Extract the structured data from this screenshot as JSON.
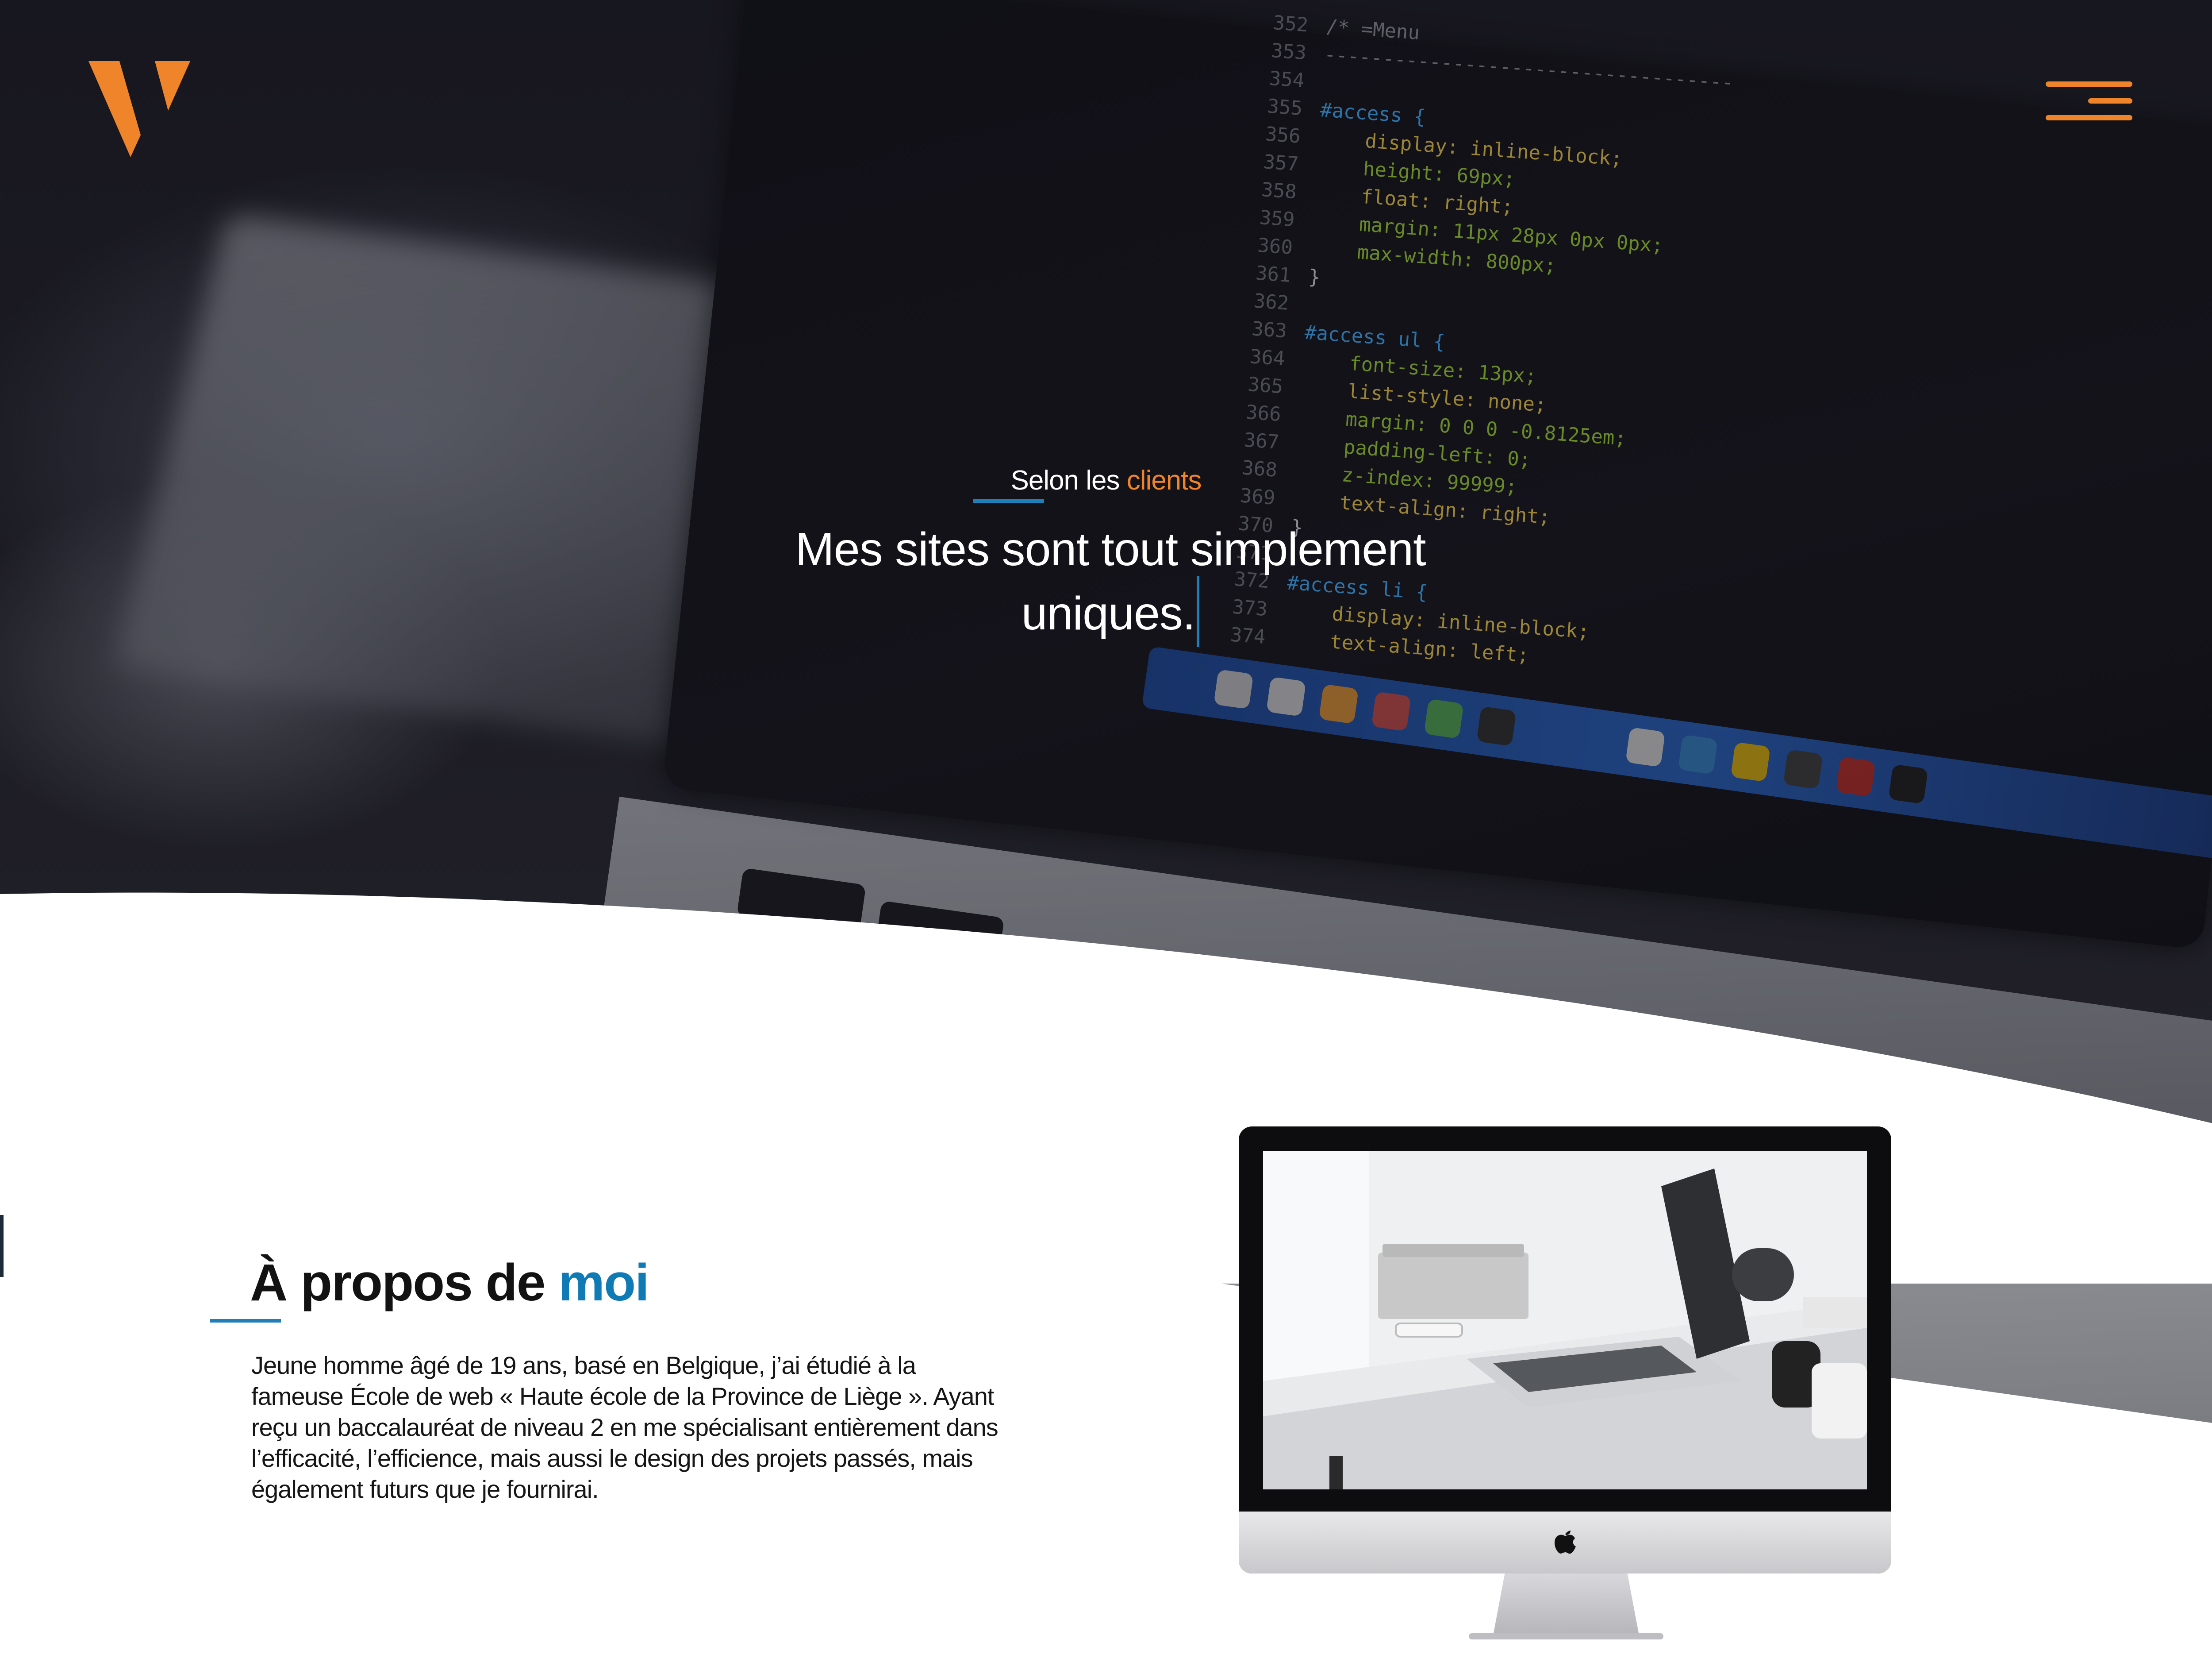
{
  "header": {
    "logo_icon": "v-logo-icon",
    "menu_icon": "hamburger-menu-icon",
    "accent_color": "#f0842a"
  },
  "hero": {
    "kicker_prefix": "Selon les",
    "kicker_accent": "clients",
    "title_line1": "Mes sites sont tout simplement",
    "title_line2": "uniques."
  },
  "code_lines": [
    {
      "n": "352",
      "t": "/* =Menu"
    },
    {
      "n": "353",
      "t": "-----------------------------------"
    },
    {
      "n": "354",
      "t": ""
    },
    {
      "n": "355",
      "t": "#access {"
    },
    {
      "n": "356",
      "t": "    display: inline-block;"
    },
    {
      "n": "357",
      "t": "    height: 69px;"
    },
    {
      "n": "358",
      "t": "    float: right;"
    },
    {
      "n": "359",
      "t": "    margin: 11px 28px 0px 0px;"
    },
    {
      "n": "360",
      "t": "    max-width: 800px;"
    },
    {
      "n": "361",
      "t": "}"
    },
    {
      "n": "362",
      "t": ""
    },
    {
      "n": "363",
      "t": "#access ul {"
    },
    {
      "n": "364",
      "t": "    font-size: 13px;"
    },
    {
      "n": "365",
      "t": "    list-style: none;"
    },
    {
      "n": "366",
      "t": "    margin: 0 0 0 -0.8125em;"
    },
    {
      "n": "367",
      "t": "    padding-left: 0;"
    },
    {
      "n": "368",
      "t": "    z-index: 99999;"
    },
    {
      "n": "369",
      "t": "    text-align: right;"
    },
    {
      "n": "370",
      "t": "}"
    },
    {
      "n": "371",
      "t": ""
    },
    {
      "n": "372",
      "t": "#access li {"
    },
    {
      "n": "373",
      "t": "    display: inline-block;"
    },
    {
      "n": "374",
      "t": "    text-align: left;"
    }
  ],
  "about": {
    "title_prefix": "À propos de",
    "title_accent": "moi",
    "accent_color": "#0f7ab4",
    "paragraph": "Jeune homme âgé de 19 ans, basé en Belgique, j’ai étudié à la fameuse École de web « Haute école de la Province de Liège ». Ayant reçu un baccalauréat de niveau 2 en me spécialisant entièrement dans l’efficacité, l’efficience, mais aussi le design des projets passés, mais également futurs que je fournirai.",
    "device_icon": "apple-icon"
  }
}
